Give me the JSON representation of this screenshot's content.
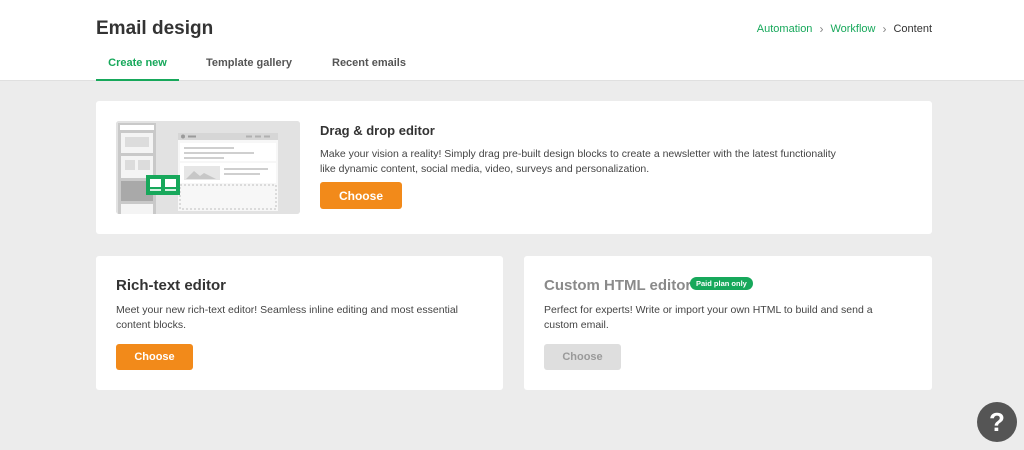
{
  "header": {
    "title": "Email design",
    "breadcrumb": [
      {
        "label": "Automation"
      },
      {
        "label": "Workflow"
      },
      {
        "label": "Content"
      }
    ],
    "tabs": [
      {
        "label": "Create new"
      },
      {
        "label": "Template gallery"
      },
      {
        "label": "Recent emails"
      }
    ]
  },
  "cards": {
    "drag_drop": {
      "title": "Drag & drop editor",
      "description": "Make your vision a reality! Simply drag pre-built design blocks to create a newsletter with the latest functionality like dynamic content, social media, video, surveys and personalization.",
      "button_label": "Choose"
    },
    "rich_text": {
      "title": "Rich-text editor",
      "description": "Meet your new rich-text editor! Seamless inline editing and most essential content blocks.",
      "button_label": "Choose"
    },
    "custom_html": {
      "title": "Custom HTML editor",
      "badge": "Paid plan only",
      "description": "Perfect for experts! Write or import your own HTML to build and send a custom email.",
      "button_label": "Choose"
    }
  },
  "help": {
    "label": "?"
  },
  "colors": {
    "accent_green": "#17a85b",
    "button_orange": "#f28a1a",
    "background": "#ececec"
  }
}
